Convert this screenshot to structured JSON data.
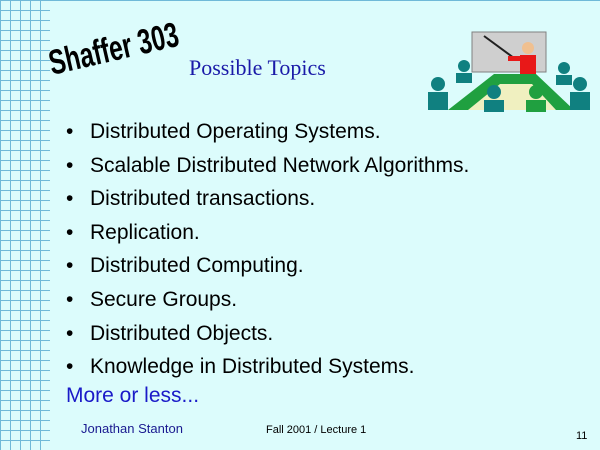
{
  "slide": {
    "logo_text": "Shaffer 303",
    "title": "Possible Topics",
    "bullets": [
      "Distributed Operating Systems.",
      "Scalable Distributed Network Algorithms.",
      "Distributed transactions.",
      "Replication.",
      "Distributed Computing.",
      "Secure Groups.",
      "Distributed Objects.",
      "Knowledge in Distributed Systems."
    ],
    "closing": "More or less...",
    "author": "Jonathan Stanton",
    "footer": "Fall  2001 / Lecture 1",
    "page_number": "11"
  },
  "colors": {
    "background": "#dcfcfc",
    "grid_lines": "#6fb9d8",
    "title": "#1a1aa8",
    "closing_text": "#1a1ac8",
    "presenter_shirt": "#e81818",
    "table": "#20a040",
    "audience_teal": "#108080"
  },
  "icons": [
    "presentation-clipart-icon"
  ]
}
